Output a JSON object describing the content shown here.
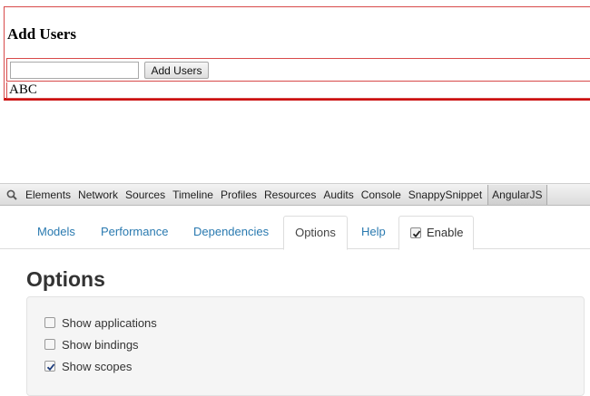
{
  "app": {
    "title": "Add Users",
    "input_value": "",
    "add_button_label": "Add Users",
    "users": [
      "ABC"
    ]
  },
  "devtools": {
    "search_icon": "magnifier-icon",
    "tabs": [
      "Elements",
      "Network",
      "Sources",
      "Timeline",
      "Profiles",
      "Resources",
      "Audits",
      "Console",
      "SnappySnippet",
      "AngularJS"
    ],
    "active_tab": "AngularJS"
  },
  "angular_panel": {
    "tabs": [
      {
        "label": "Models"
      },
      {
        "label": "Performance"
      },
      {
        "label": "Dependencies"
      },
      {
        "label": "Options"
      },
      {
        "label": "Help"
      }
    ],
    "selected_tab": "Options",
    "enable": {
      "label": "Enable",
      "checked": true
    },
    "heading": "Options",
    "options": [
      {
        "label": "Show applications",
        "checked": false
      },
      {
        "label": "Show bindings",
        "checked": false
      },
      {
        "label": "Show scopes",
        "checked": true
      }
    ]
  },
  "colors": {
    "link": "#2a7ab0",
    "debug_outline": "#cc1111"
  }
}
